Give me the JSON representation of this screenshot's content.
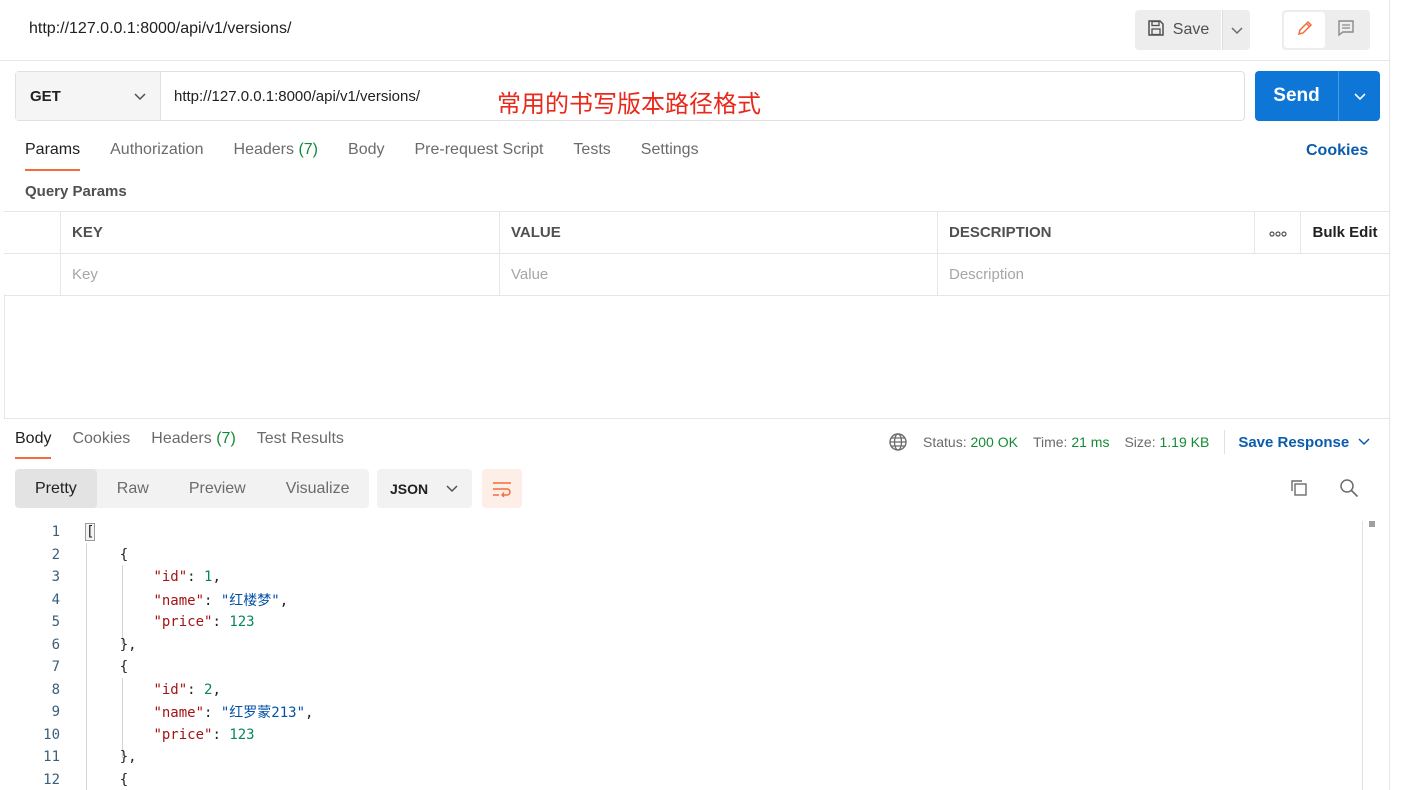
{
  "header": {
    "request_title": "http://127.0.0.1:8000/api/v1/versions/",
    "save_label": "Save"
  },
  "request": {
    "method": "GET",
    "url": "http://127.0.0.1:8000/api/v1/versions/",
    "annotation": "常用的书写版本路径格式",
    "send_label": "Send"
  },
  "request_tabs": [
    {
      "label": "Params"
    },
    {
      "label": "Authorization"
    },
    {
      "label": "Headers",
      "count": "(7)"
    },
    {
      "label": "Body"
    },
    {
      "label": "Pre-request Script"
    },
    {
      "label": "Tests"
    },
    {
      "label": "Settings"
    }
  ],
  "cookies_link": "Cookies",
  "query_params": {
    "title": "Query Params",
    "headers": [
      "KEY",
      "VALUE",
      "DESCRIPTION"
    ],
    "bulk_edit": "Bulk Edit",
    "placeholders": [
      "Key",
      "Value",
      "Description"
    ]
  },
  "response_tabs": [
    {
      "label": "Body"
    },
    {
      "label": "Cookies"
    },
    {
      "label": "Headers",
      "count": "(7)"
    },
    {
      "label": "Test Results"
    }
  ],
  "response_meta": {
    "status_label": "Status:",
    "status_value": "200 OK",
    "time_label": "Time:",
    "time_value": "21 ms",
    "size_label": "Size:",
    "size_value": "1.19 KB",
    "save_response": "Save Response"
  },
  "format_tabs": [
    "Pretty",
    "Raw",
    "Preview",
    "Visualize"
  ],
  "format_type": "JSON",
  "code_lines": [
    {
      "n": "1",
      "text": "["
    },
    {
      "n": "2",
      "text": "    {"
    },
    {
      "n": "3",
      "text": "        \"id\": 1,"
    },
    {
      "n": "4",
      "text": "        \"name\": \"红楼梦\","
    },
    {
      "n": "5",
      "text": "        \"price\": 123"
    },
    {
      "n": "6",
      "text": "    },"
    },
    {
      "n": "7",
      "text": "    {"
    },
    {
      "n": "8",
      "text": "        \"id\": 2,"
    },
    {
      "n": "9",
      "text": "        \"name\": \"红罗蒙213\","
    },
    {
      "n": "10",
      "text": "        \"price\": 123"
    },
    {
      "n": "11",
      "text": "    },"
    },
    {
      "n": "12",
      "text": "    {"
    }
  ],
  "colors": {
    "accent": "#f26b3a",
    "primary": "#0d76d6",
    "success": "#138a36",
    "annotation": "#e8291c"
  }
}
